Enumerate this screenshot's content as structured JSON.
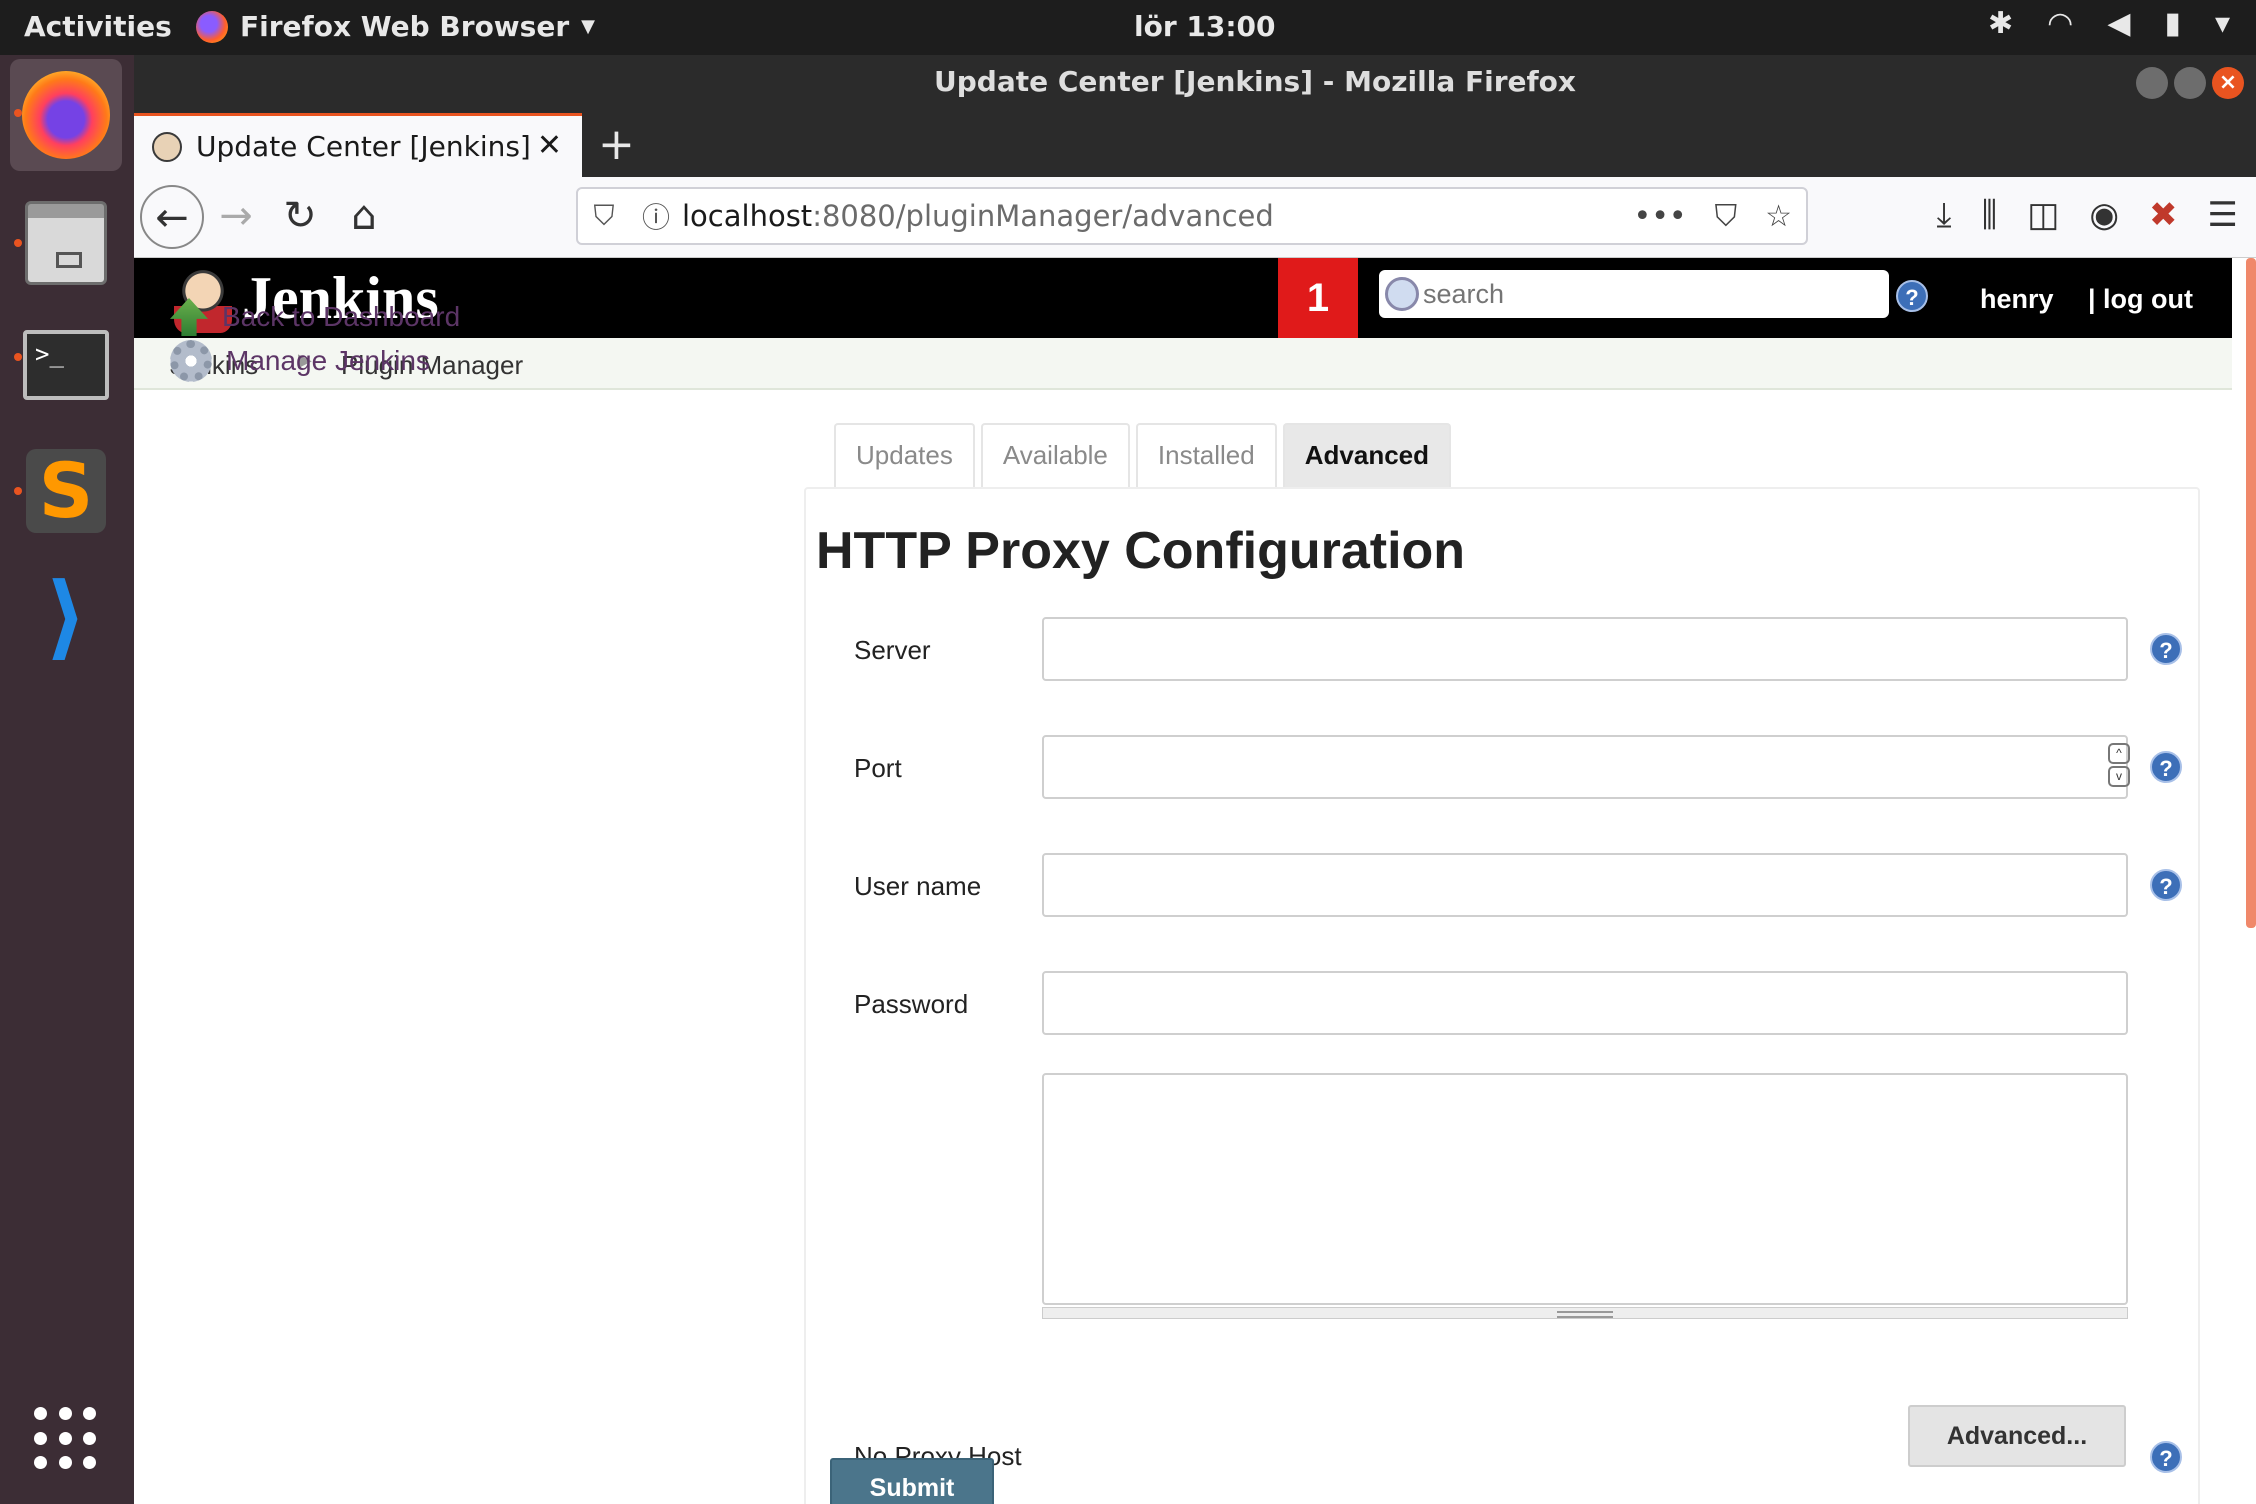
{
  "system": {
    "activities": "Activities",
    "app_name": "Firefox Web Browser",
    "clock": "lör 13:00"
  },
  "window": {
    "title": "Update Center [Jenkins] - Mozilla Firefox"
  },
  "browser": {
    "tab_title": "Update Center [Jenkins]",
    "url_host": "localhost",
    "url_rest": ":8080/pluginManager/advanced"
  },
  "jenkins": {
    "logo_text": "Jenkins",
    "notification_count": "1",
    "search_placeholder": "search",
    "user": "henry",
    "logout": "| log out",
    "breadcrumbs": [
      "Jenkins",
      "Plugin Manager"
    ],
    "sidebar": [
      {
        "label": "Back to Dashboard"
      },
      {
        "label": "Manage Jenkins"
      }
    ],
    "tabs": [
      {
        "label": "Updates"
      },
      {
        "label": "Available"
      },
      {
        "label": "Installed"
      },
      {
        "label": "Advanced",
        "active": true
      }
    ],
    "heading": "HTTP Proxy Configuration",
    "fields": {
      "server": {
        "label": "Server",
        "value": ""
      },
      "port": {
        "label": "Port",
        "value": ""
      },
      "username": {
        "label": "User name",
        "value": ""
      },
      "password": {
        "label": "Password",
        "value": ""
      },
      "no_proxy": {
        "label": "No Proxy Host",
        "value": ""
      }
    },
    "advanced_button": "Advanced...",
    "submit_button": "Submit"
  },
  "colors": {
    "jenkins_header": "#000000",
    "notification": "#e01a1a",
    "submit": "#4b758b",
    "link": "#5c3566",
    "ubuntu_accent": "#e95420"
  }
}
